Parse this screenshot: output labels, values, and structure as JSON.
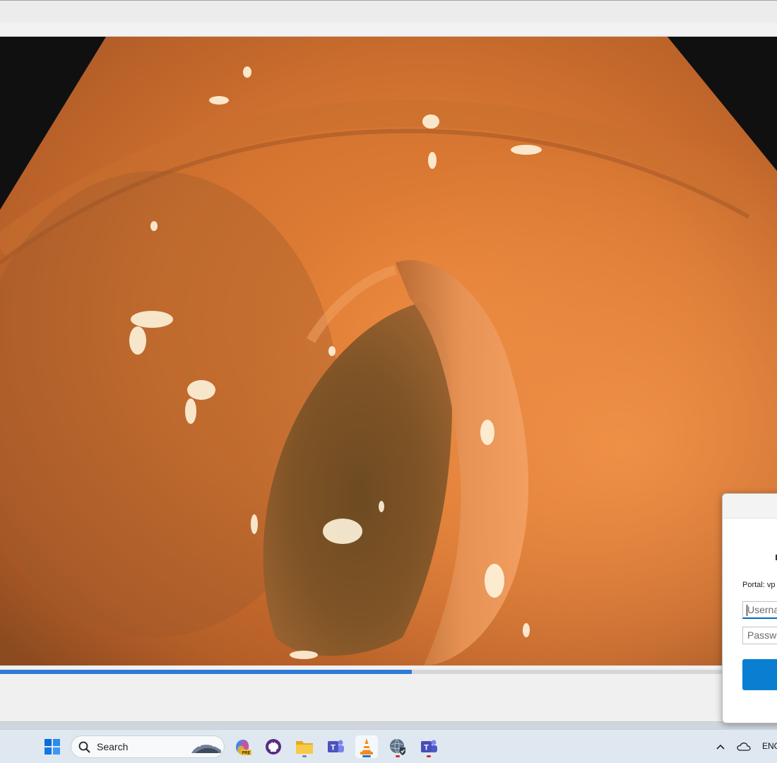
{
  "player": {
    "progress_percent": 53
  },
  "login_dialog": {
    "portal_label": "Portal: vp",
    "username_placeholder": "Userna",
    "password_placeholder": "Passwo"
  },
  "taskbar": {
    "search_label": "Search",
    "apps": [
      {
        "icon": "windows-start-icon"
      },
      {
        "icon": "copilot-pre-icon"
      },
      {
        "icon": "github-icon"
      },
      {
        "icon": "file-explorer-icon"
      },
      {
        "icon": "teams-icon"
      },
      {
        "icon": "vlc-icon"
      },
      {
        "icon": "globalprotect-icon"
      },
      {
        "icon": "teams-classic-icon"
      }
    ],
    "tray": {
      "language": "ENG"
    }
  },
  "colors": {
    "accent": "#2f7ad6",
    "dialog_button": "#0a7fd1",
    "mucosa": "#d8782e"
  }
}
